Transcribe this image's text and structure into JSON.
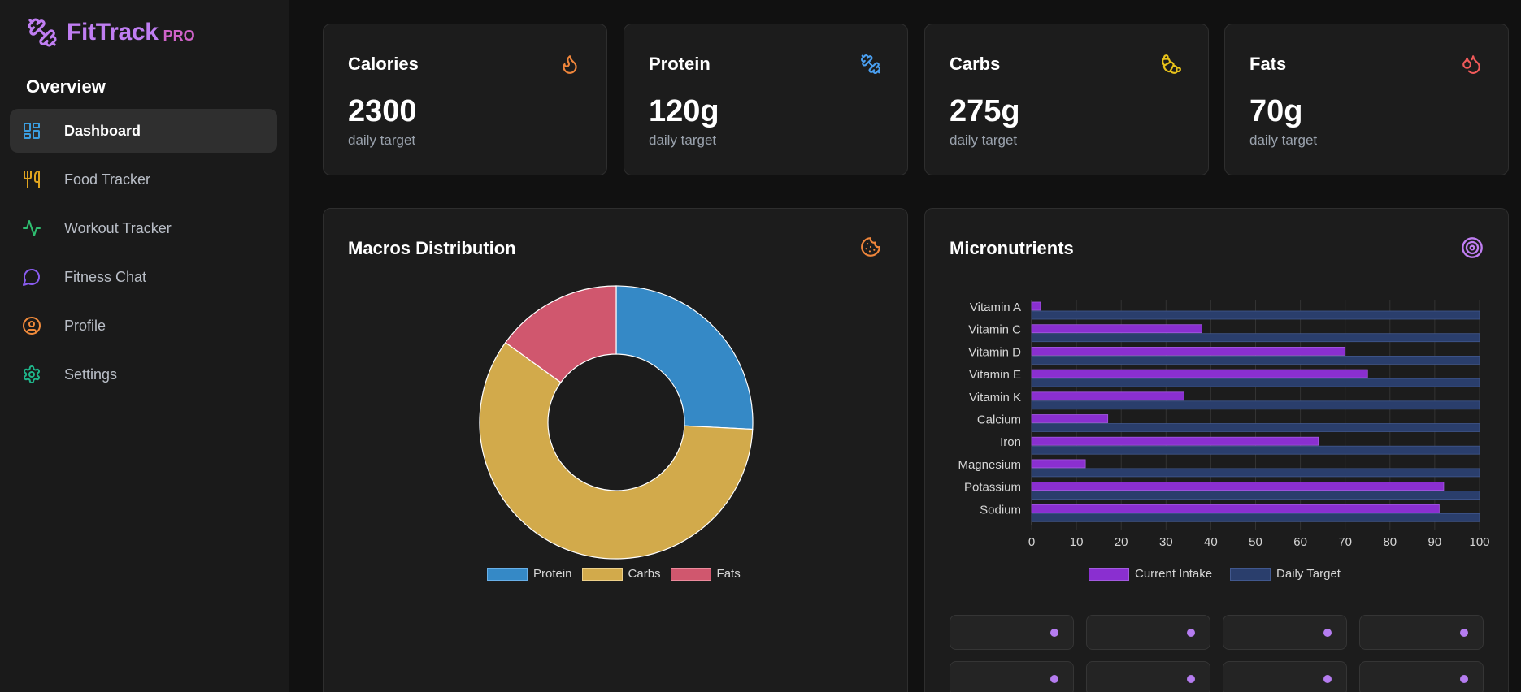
{
  "brand": {
    "name": "FitTrack",
    "badge": "PRO",
    "icon": "dumbbell-icon"
  },
  "sidebar": {
    "section_title": "Overview",
    "items": [
      {
        "label": "Dashboard",
        "icon": "dashboard-icon",
        "color": "#3b9ee0",
        "active": true
      },
      {
        "label": "Food Tracker",
        "icon": "utensils-icon",
        "color": "#e0a41f",
        "active": false
      },
      {
        "label": "Workout Tracker",
        "icon": "activity-icon",
        "color": "#2fbf71",
        "active": false
      },
      {
        "label": "Fitness Chat",
        "icon": "chat-icon",
        "color": "#8a5cf0",
        "active": false
      },
      {
        "label": "Profile",
        "icon": "user-circle-icon",
        "color": "#f08a3b",
        "active": false
      },
      {
        "label": "Settings",
        "icon": "gear-icon",
        "color": "#1fb58a",
        "active": false
      }
    ]
  },
  "stats": [
    {
      "title": "Calories",
      "value": "2300",
      "sub": "daily target",
      "icon": "flame-icon",
      "color": "#f0863b"
    },
    {
      "title": "Protein",
      "value": "120g",
      "sub": "daily target",
      "icon": "dumbbell-icon",
      "color": "#4a9ff0"
    },
    {
      "title": "Carbs",
      "value": "275g",
      "sub": "daily target",
      "icon": "croissant-icon",
      "color": "#e8c21a"
    },
    {
      "title": "Fats",
      "value": "70g",
      "sub": "daily target",
      "icon": "droplets-icon",
      "color": "#f05a5a"
    }
  ],
  "macros_panel": {
    "title": "Macros Distribution",
    "icon": "cookie-icon",
    "icon_color": "#f0863b"
  },
  "micro_panel": {
    "title": "Micronutrients",
    "icon": "target-icon",
    "icon_color": "#c07ef2"
  },
  "chart_data": [
    {
      "type": "pie",
      "donut": true,
      "categories": [
        "Protein",
        "Carbs",
        "Fats"
      ],
      "values": [
        120,
        275,
        70
      ],
      "colors": [
        "#3589c6",
        "#d2aa4b",
        "#d0576e"
      ],
      "legend": "bottom"
    },
    {
      "type": "bar",
      "orientation": "horizontal",
      "categories": [
        "Vitamin A",
        "Vitamin C",
        "Vitamin D",
        "Vitamin E",
        "Vitamin K",
        "Calcium",
        "Iron",
        "Magnesium",
        "Potassium",
        "Sodium"
      ],
      "series": [
        {
          "name": "Current Intake",
          "values": [
            2,
            38,
            70,
            75,
            34,
            17,
            64,
            12,
            92,
            91
          ],
          "color": "#8a2fd0"
        },
        {
          "name": "Daily Target",
          "values": [
            100,
            100,
            100,
            100,
            100,
            100,
            100,
            100,
            100,
            100
          ],
          "color": "#2a3e6c"
        }
      ],
      "xlim": [
        0,
        100
      ],
      "xticks": [
        0,
        10,
        20,
        30,
        40,
        50,
        60,
        70,
        80,
        90,
        100
      ],
      "grid": true,
      "legend": "bottom"
    }
  ]
}
